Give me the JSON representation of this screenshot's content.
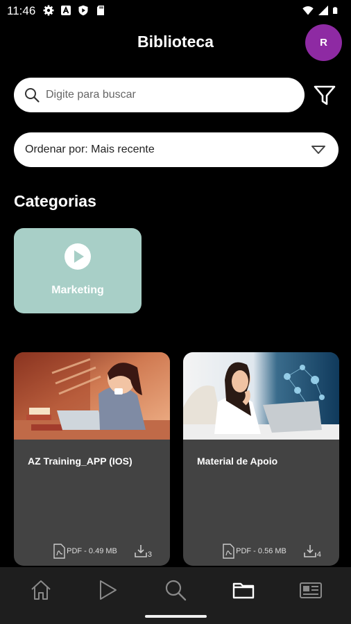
{
  "status_bar": {
    "time": "11:46",
    "left_icons": [
      "settings-icon",
      "a-box-icon",
      "shield-icon",
      "sd-card-icon"
    ],
    "right_icons": [
      "wifi-icon",
      "signal-icon",
      "battery-icon"
    ]
  },
  "header": {
    "title": "Biblioteca",
    "avatar_initial": "R",
    "avatar_color": "#8e2aa3"
  },
  "search": {
    "placeholder": "Digite para buscar",
    "value": ""
  },
  "sort": {
    "label": "Ordenar por: Mais recente"
  },
  "categories": {
    "title": "Categorias",
    "items": [
      {
        "label": "Marketing",
        "color": "#a8cfc7",
        "icon": "play-circle-icon"
      }
    ]
  },
  "content": {
    "items": [
      {
        "title": "AZ Training_APP (IOS)",
        "file_info": "PDF - 0.49 MB",
        "downloads": "3"
      },
      {
        "title": "Material de Apoio",
        "file_info": "PDF - 0.56 MB",
        "downloads": "4"
      }
    ]
  },
  "bottom_nav": {
    "items": [
      "home-icon",
      "play-icon",
      "search-icon",
      "folder-icon",
      "news-icon"
    ],
    "active": "folder-icon"
  }
}
